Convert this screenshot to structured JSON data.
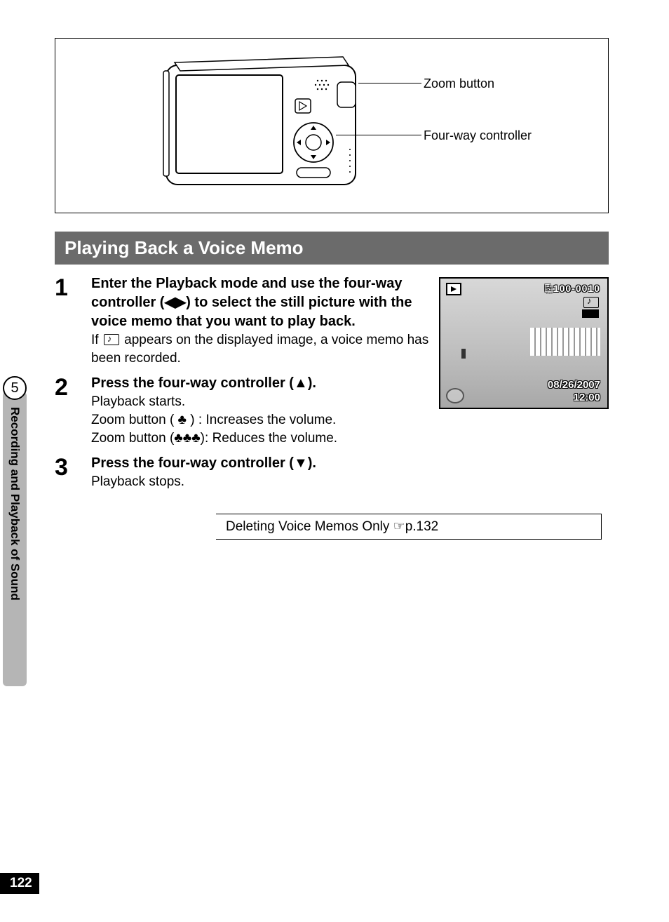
{
  "diagram_labels": {
    "zoom": "Zoom button",
    "fourway": "Four-way controller"
  },
  "section_heading": "Playing Back a Voice Memo",
  "steps": [
    {
      "num": "1",
      "title_pre": "Enter the Playback mode and use the four-way controller (",
      "title_sym": "◀▶",
      "title_post": ") to select the still picture with the voice memo that you want to play back.",
      "sub1_pre": "If ",
      "sub1_post": " appears on the displayed image, a voice memo has been recorded."
    },
    {
      "num": "2",
      "title_pre": "Press the four-way controller (",
      "title_sym": "▲",
      "title_post": ").",
      "sub_lines": [
        "Playback starts.",
        "Zoom button ( ♣ )  :  Increases the volume.",
        "Zoom button (♣♣♣):  Reduces the volume."
      ]
    },
    {
      "num": "3",
      "title_pre": "Press the four-way controller (",
      "title_sym": "▼",
      "title_post": ").",
      "sub_lines": [
        "Playback stops."
      ]
    }
  ],
  "screenshot": {
    "folder": "100-0010",
    "date": "08/26/2007",
    "time": "12:00"
  },
  "reference": "Deleting Voice Memos Only ☞p.132",
  "side_tab": {
    "chapter": "5",
    "title": "Recording and Playback of Sound"
  },
  "page_number": "122"
}
